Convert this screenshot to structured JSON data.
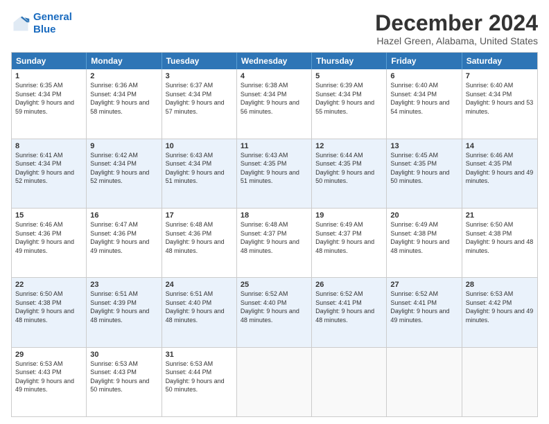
{
  "logo": {
    "line1": "General",
    "line2": "Blue"
  },
  "title": "December 2024",
  "subtitle": "Hazel Green, Alabama, United States",
  "days": [
    "Sunday",
    "Monday",
    "Tuesday",
    "Wednesday",
    "Thursday",
    "Friday",
    "Saturday"
  ],
  "weeks": [
    [
      {
        "day": "1",
        "sunrise": "6:35 AM",
        "sunset": "4:34 PM",
        "daylight": "9 hours and 59 minutes."
      },
      {
        "day": "2",
        "sunrise": "6:36 AM",
        "sunset": "4:34 PM",
        "daylight": "9 hours and 58 minutes."
      },
      {
        "day": "3",
        "sunrise": "6:37 AM",
        "sunset": "4:34 PM",
        "daylight": "9 hours and 57 minutes."
      },
      {
        "day": "4",
        "sunrise": "6:38 AM",
        "sunset": "4:34 PM",
        "daylight": "9 hours and 56 minutes."
      },
      {
        "day": "5",
        "sunrise": "6:39 AM",
        "sunset": "4:34 PM",
        "daylight": "9 hours and 55 minutes."
      },
      {
        "day": "6",
        "sunrise": "6:40 AM",
        "sunset": "4:34 PM",
        "daylight": "9 hours and 54 minutes."
      },
      {
        "day": "7",
        "sunrise": "6:40 AM",
        "sunset": "4:34 PM",
        "daylight": "9 hours and 53 minutes."
      }
    ],
    [
      {
        "day": "8",
        "sunrise": "6:41 AM",
        "sunset": "4:34 PM",
        "daylight": "9 hours and 52 minutes."
      },
      {
        "day": "9",
        "sunrise": "6:42 AM",
        "sunset": "4:34 PM",
        "daylight": "9 hours and 52 minutes."
      },
      {
        "day": "10",
        "sunrise": "6:43 AM",
        "sunset": "4:34 PM",
        "daylight": "9 hours and 51 minutes."
      },
      {
        "day": "11",
        "sunrise": "6:43 AM",
        "sunset": "4:35 PM",
        "daylight": "9 hours and 51 minutes."
      },
      {
        "day": "12",
        "sunrise": "6:44 AM",
        "sunset": "4:35 PM",
        "daylight": "9 hours and 50 minutes."
      },
      {
        "day": "13",
        "sunrise": "6:45 AM",
        "sunset": "4:35 PM",
        "daylight": "9 hours and 50 minutes."
      },
      {
        "day": "14",
        "sunrise": "6:46 AM",
        "sunset": "4:35 PM",
        "daylight": "9 hours and 49 minutes."
      }
    ],
    [
      {
        "day": "15",
        "sunrise": "6:46 AM",
        "sunset": "4:36 PM",
        "daylight": "9 hours and 49 minutes."
      },
      {
        "day": "16",
        "sunrise": "6:47 AM",
        "sunset": "4:36 PM",
        "daylight": "9 hours and 49 minutes."
      },
      {
        "day": "17",
        "sunrise": "6:48 AM",
        "sunset": "4:36 PM",
        "daylight": "9 hours and 48 minutes."
      },
      {
        "day": "18",
        "sunrise": "6:48 AM",
        "sunset": "4:37 PM",
        "daylight": "9 hours and 48 minutes."
      },
      {
        "day": "19",
        "sunrise": "6:49 AM",
        "sunset": "4:37 PM",
        "daylight": "9 hours and 48 minutes."
      },
      {
        "day": "20",
        "sunrise": "6:49 AM",
        "sunset": "4:38 PM",
        "daylight": "9 hours and 48 minutes."
      },
      {
        "day": "21",
        "sunrise": "6:50 AM",
        "sunset": "4:38 PM",
        "daylight": "9 hours and 48 minutes."
      }
    ],
    [
      {
        "day": "22",
        "sunrise": "6:50 AM",
        "sunset": "4:38 PM",
        "daylight": "9 hours and 48 minutes."
      },
      {
        "day": "23",
        "sunrise": "6:51 AM",
        "sunset": "4:39 PM",
        "daylight": "9 hours and 48 minutes."
      },
      {
        "day": "24",
        "sunrise": "6:51 AM",
        "sunset": "4:40 PM",
        "daylight": "9 hours and 48 minutes."
      },
      {
        "day": "25",
        "sunrise": "6:52 AM",
        "sunset": "4:40 PM",
        "daylight": "9 hours and 48 minutes."
      },
      {
        "day": "26",
        "sunrise": "6:52 AM",
        "sunset": "4:41 PM",
        "daylight": "9 hours and 48 minutes."
      },
      {
        "day": "27",
        "sunrise": "6:52 AM",
        "sunset": "4:41 PM",
        "daylight": "9 hours and 49 minutes."
      },
      {
        "day": "28",
        "sunrise": "6:53 AM",
        "sunset": "4:42 PM",
        "daylight": "9 hours and 49 minutes."
      }
    ],
    [
      {
        "day": "29",
        "sunrise": "6:53 AM",
        "sunset": "4:43 PM",
        "daylight": "9 hours and 49 minutes."
      },
      {
        "day": "30",
        "sunrise": "6:53 AM",
        "sunset": "4:43 PM",
        "daylight": "9 hours and 50 minutes."
      },
      {
        "day": "31",
        "sunrise": "6:53 AM",
        "sunset": "4:44 PM",
        "daylight": "9 hours and 50 minutes."
      },
      null,
      null,
      null,
      null
    ]
  ]
}
